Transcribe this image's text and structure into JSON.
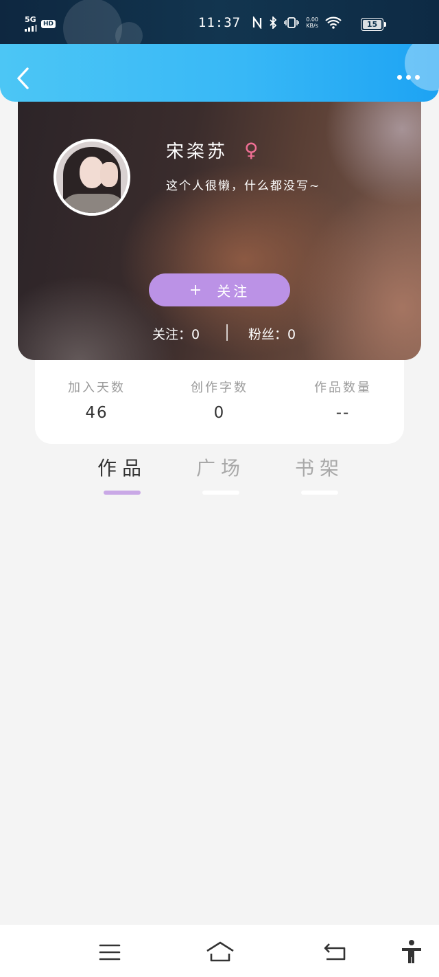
{
  "status_bar": {
    "signal": "5G",
    "hd": "HD",
    "time": "11:37",
    "network_speed_value": "0.00",
    "network_speed_unit": "KB/s",
    "battery": "15",
    "icons": [
      "nfc-icon",
      "bluetooth-icon",
      "vibrate-icon",
      "wifi-icon",
      "battery-icon"
    ]
  },
  "header": {
    "back_icon": "chevron-left-icon",
    "more_icon": "more-horizontal-icon"
  },
  "profile": {
    "nickname": "宋栥苏",
    "gender_symbol": "♀",
    "bio": "这个人很懒，什么都没写~",
    "follow_label": "关注",
    "follow_plus": "+",
    "following_text": "关注：0",
    "fans_text": "粉丝：0"
  },
  "stats": [
    {
      "label": "加入天数",
      "value": "46"
    },
    {
      "label": "创作字数",
      "value": "0"
    },
    {
      "label": "作品数量",
      "value": "--"
    }
  ],
  "tabs": [
    {
      "label": "作品",
      "active": true
    },
    {
      "label": "广场",
      "active": false
    },
    {
      "label": "书架",
      "active": false
    }
  ],
  "nav_bar": {
    "icons": [
      "menu-icon",
      "home-icon",
      "back-icon",
      "accessibility-icon"
    ]
  },
  "colors": {
    "header_blue": "#38b8f6",
    "follow_purple": "#bb92e6",
    "tab_indicator": "#c9a8e6",
    "female_pink": "#ef6f94"
  }
}
